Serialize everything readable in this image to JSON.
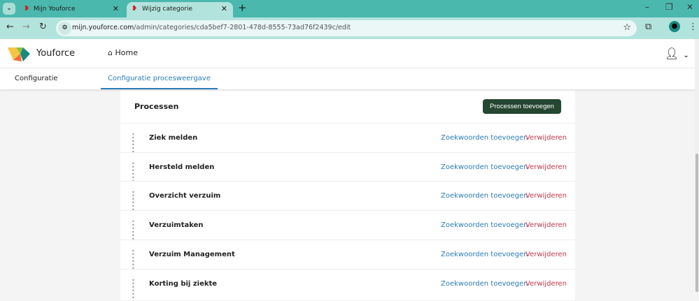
{
  "browser": {
    "tabs": [
      {
        "title": "Mijn Youforce"
      },
      {
        "title": "Wijzig categorie"
      }
    ],
    "url_domain": "mijn.youforce.com",
    "url_path": "/admin/categories/cda5bef7-2801-478d-8555-73ad76f2439c/edit"
  },
  "header": {
    "brand": "Youforce",
    "home": "Home"
  },
  "subnav": {
    "tabs": [
      "Configuratie",
      "Configuratie procesweergave"
    ]
  },
  "card": {
    "title": "Processen",
    "add_button": "Processen toevoegen",
    "rows": [
      {
        "name": "Ziek melden",
        "keywords": "Zoekwoorden toevoegen",
        "delete": "Verwijderen"
      },
      {
        "name": "Hersteld melden",
        "keywords": "Zoekwoorden toevoegen",
        "delete": "Verwijderen"
      },
      {
        "name": "Overzicht verzuim",
        "keywords": "Zoekwoorden toevoegen",
        "delete": "Verwijderen"
      },
      {
        "name": "Verzuimtaken",
        "keywords": "Zoekwoorden toevoegen",
        "delete": "Verwijderen"
      },
      {
        "name": "Verzuim Management",
        "keywords": "Zoekwoorden toevoegen",
        "delete": "Verwijderen"
      },
      {
        "name": "Korting bij ziekte",
        "keywords": "Zoekwoorden toevoegen",
        "delete": "Verwijderen"
      }
    ]
  },
  "colors": {
    "accent": "#2b7cb8",
    "danger": "#c9384a",
    "button": "#254631",
    "chrome": "#4bb8ae"
  }
}
